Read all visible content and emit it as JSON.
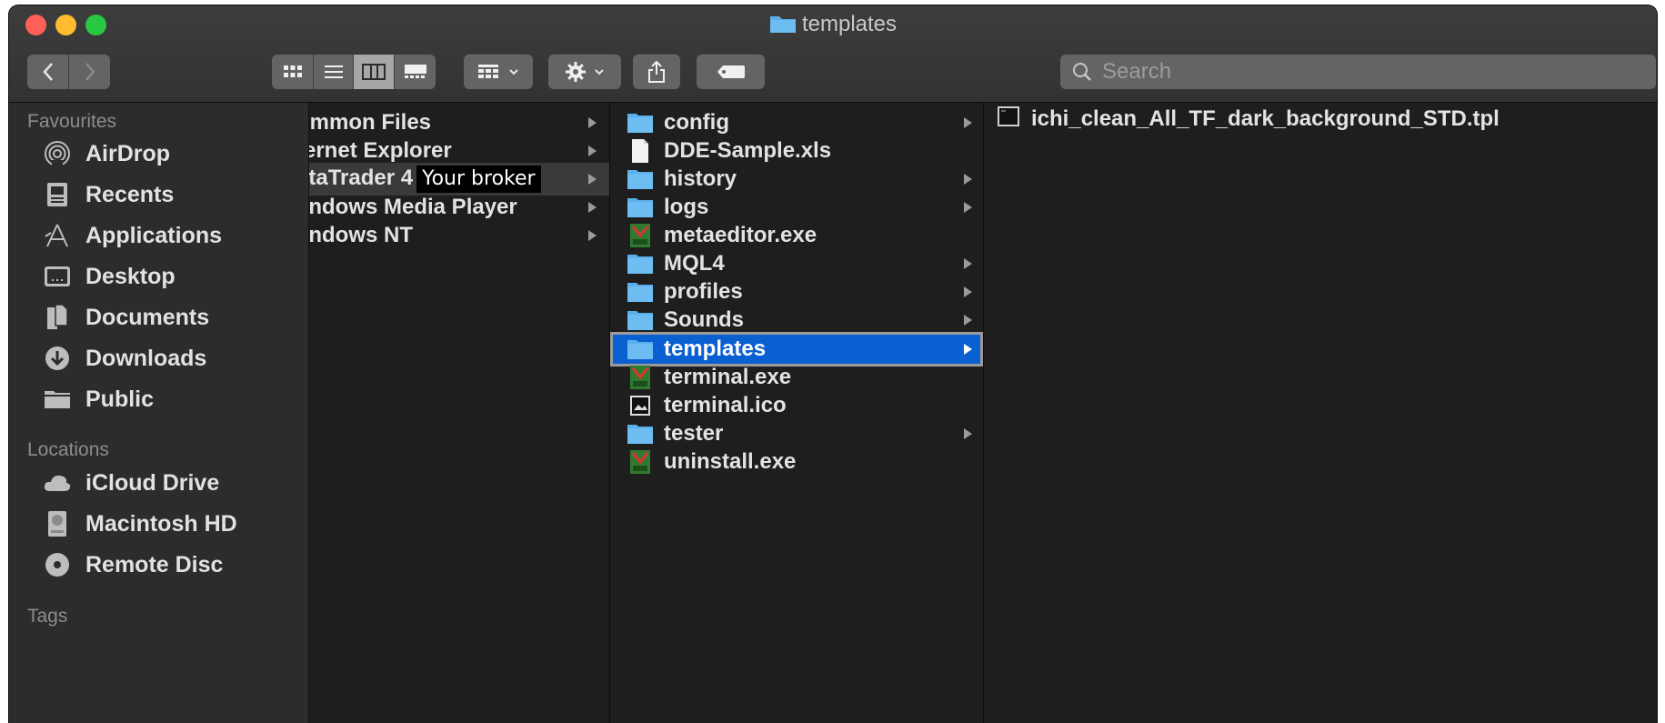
{
  "window": {
    "title": "templates"
  },
  "toolbar": {
    "back_icon": "chevron-left-icon",
    "forward_icon": "chevron-right-icon",
    "view_modes": [
      "icon-view",
      "list-view",
      "column-view",
      "gallery-view"
    ],
    "active_view": "column-view",
    "group_icon": "group-grid-icon",
    "action_icon": "gear-icon",
    "share_icon": "share-icon",
    "tag_icon": "tag-icon",
    "search": {
      "placeholder": "Search",
      "value": ""
    }
  },
  "sidebar": {
    "sections": [
      {
        "heading": "Favourites",
        "items": [
          {
            "label": "AirDrop",
            "icon": "airdrop-icon"
          },
          {
            "label": "Recents",
            "icon": "recents-icon"
          },
          {
            "label": "Applications",
            "icon": "applications-icon"
          },
          {
            "label": "Desktop",
            "icon": "desktop-icon"
          },
          {
            "label": "Documents",
            "icon": "documents-icon"
          },
          {
            "label": "Downloads",
            "icon": "downloads-icon"
          },
          {
            "label": "Public",
            "icon": "folder-icon"
          }
        ]
      },
      {
        "heading": "Locations",
        "items": [
          {
            "label": "iCloud Drive",
            "icon": "cloud-icon"
          },
          {
            "label": "Macintosh HD",
            "icon": "harddisk-icon"
          },
          {
            "label": "Remote Disc",
            "icon": "disc-icon"
          }
        ]
      },
      {
        "heading": "Tags",
        "items": []
      }
    ]
  },
  "columns": {
    "col1": [
      {
        "label": "ommon Files",
        "has_children": true
      },
      {
        "label": "ternet Explorer",
        "has_children": true
      },
      {
        "label": "etaTrader 4",
        "suffix": "Your broker",
        "has_children": true,
        "highlighted": true
      },
      {
        "label": "/indows Media Player",
        "has_children": true
      },
      {
        "label": "/indows NT",
        "has_children": true
      }
    ],
    "col2": [
      {
        "label": "config",
        "type": "folder",
        "has_children": true
      },
      {
        "label": "DDE-Sample.xls",
        "type": "document",
        "has_children": false
      },
      {
        "label": "history",
        "type": "folder",
        "has_children": true
      },
      {
        "label": "logs",
        "type": "folder",
        "has_children": true
      },
      {
        "label": "metaeditor.exe",
        "type": "exe",
        "has_children": false
      },
      {
        "label": "MQL4",
        "type": "folder",
        "has_children": true
      },
      {
        "label": "profiles",
        "type": "folder",
        "has_children": true
      },
      {
        "label": "Sounds",
        "type": "folder",
        "has_children": true
      },
      {
        "label": "templates",
        "type": "folder",
        "has_children": true,
        "selected": true
      },
      {
        "label": "terminal.exe",
        "type": "exe",
        "has_children": false
      },
      {
        "label": "terminal.ico",
        "type": "image",
        "has_children": false
      },
      {
        "label": "tester",
        "type": "folder",
        "has_children": true
      },
      {
        "label": "uninstall.exe",
        "type": "exe",
        "has_children": false
      }
    ],
    "col3": [
      {
        "label": "ichi_clean_All_TF_dark_background_STD.tpl",
        "type": "tpl"
      }
    ]
  },
  "colors": {
    "selection": "#0a5fd1",
    "folder": "#5ab0ec",
    "sidebar_bg": "#2c2c2c",
    "content_bg": "#1e1e1e"
  }
}
